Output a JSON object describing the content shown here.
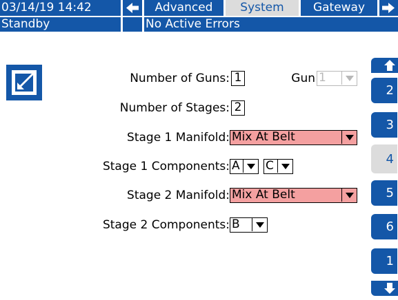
{
  "header": {
    "datetime": "03/14/19 14:42",
    "tabs": [
      {
        "label": "Advanced"
      },
      {
        "label": "System"
      },
      {
        "label": "Gateway"
      }
    ],
    "status": "Standby",
    "errors": "No Active Errors"
  },
  "form": {
    "num_guns_label": "Number of Guns:",
    "num_guns_value": "1",
    "gun_label": "Gun",
    "gun_value": "1",
    "num_stages_label": "Number of Stages:",
    "num_stages_value": "2",
    "stage1_manifold_label": "Stage 1 Manifold:",
    "stage1_manifold_value": "Mix At Belt",
    "stage1_components_label": "Stage 1 Components:",
    "stage1_comp_a": "A",
    "stage1_comp_c": "C",
    "stage2_manifold_label": "Stage 2 Manifold:",
    "stage2_manifold_value": "Mix At Belt",
    "stage2_components_label": "Stage 2 Components:",
    "stage2_comp_b": "B"
  },
  "sidebar": {
    "pages": [
      "2",
      "3",
      "4",
      "5",
      "6",
      "1"
    ],
    "selected": "4"
  },
  "colors": {
    "accent": "#1457a8",
    "highlight_field": "#f4a0a0",
    "selected_tab": "#dcdcdc"
  }
}
